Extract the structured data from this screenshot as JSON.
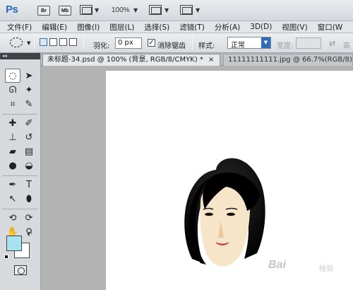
{
  "app": {
    "logo": "Ps",
    "bridge_label": "Br",
    "minibridge_label": "Mb",
    "zoom_level": "100%"
  },
  "menu": [
    "文件(F)",
    "编辑(E)",
    "图像(I)",
    "图层(L)",
    "选择(S)",
    "滤镜(T)",
    "分析(A)",
    "3D(D)",
    "视图(V)",
    "窗口(W"
  ],
  "options": {
    "feather_label": "羽化:",
    "feather_value": "0 px",
    "antialias_label": "消除锯齿",
    "antialias_checked": "✓",
    "style_label": "样式:",
    "style_value": "正常",
    "width_label": "宽度:",
    "height_label": "高"
  },
  "tabs": [
    {
      "label": "未标题-34.psd @ 100% (背景, RGB/8/CMYK) *",
      "close": "×"
    },
    {
      "label": "11111111111.jpg @ 66.7%(RGB/8) *"
    }
  ],
  "tool_panel": {
    "collapse_glyph": "◂◂"
  },
  "colors": {
    "foreground": "#a8e3f2",
    "background": "#ffffff",
    "accent": "#2f6cb5"
  },
  "watermark": {
    "text": "Bai",
    "sub": "经验"
  }
}
